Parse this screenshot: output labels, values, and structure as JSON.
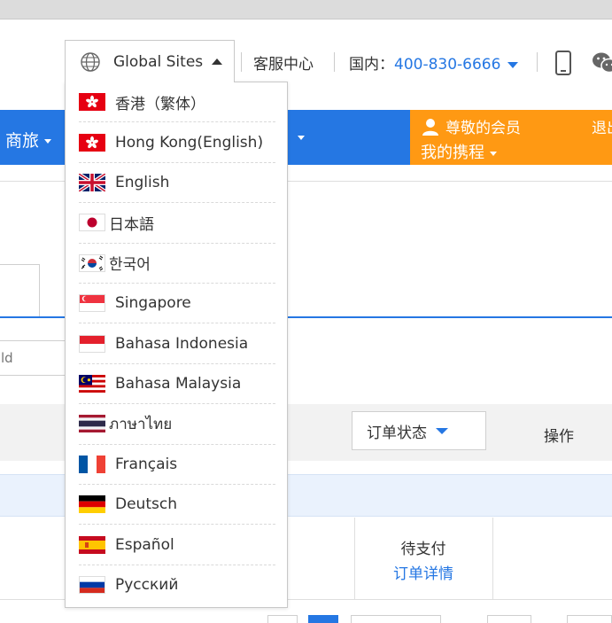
{
  "header": {
    "global_sites_label": "Global Sites",
    "service_center": "客服中心",
    "domestic_label": "国内：",
    "phone_number": "400-830-6666"
  },
  "nav": {
    "business_travel": "商旅",
    "member_greeting": "尊敬的会员",
    "my_ctrip": "我的携程",
    "logout": "退出"
  },
  "orders": {
    "search_placeholder": "ld",
    "status_filter": "订单状态",
    "actions_header": "操作",
    "row_status": "待支付",
    "row_detail_link": "订单详情"
  },
  "global_sites_menu": [
    {
      "label": "香港（繁体）",
      "flag": "hong-kong-flag-icon"
    },
    {
      "label": "Hong Kong(English)",
      "flag": "hong-kong-flag-icon"
    },
    {
      "label": "English",
      "flag": "uk-flag-icon"
    },
    {
      "label": "日本語",
      "flag": "japan-flag-icon"
    },
    {
      "label": "한국어",
      "flag": "korea-flag-icon"
    },
    {
      "label": "Singapore",
      "flag": "singapore-flag-icon"
    },
    {
      "label": "Bahasa Indonesia",
      "flag": "indonesia-flag-icon"
    },
    {
      "label": "Bahasa Malaysia",
      "flag": "malaysia-flag-icon"
    },
    {
      "label": "ภาษาไทย",
      "flag": "thailand-flag-icon"
    },
    {
      "label": "Français",
      "flag": "france-flag-icon"
    },
    {
      "label": "Deutsch",
      "flag": "germany-flag-icon"
    },
    {
      "label": "Español",
      "flag": "spain-flag-icon"
    },
    {
      "label": "Русский",
      "flag": "russia-flag-icon"
    }
  ],
  "colors": {
    "brand_blue": "#2577e3",
    "member_orange": "#ff9913"
  }
}
